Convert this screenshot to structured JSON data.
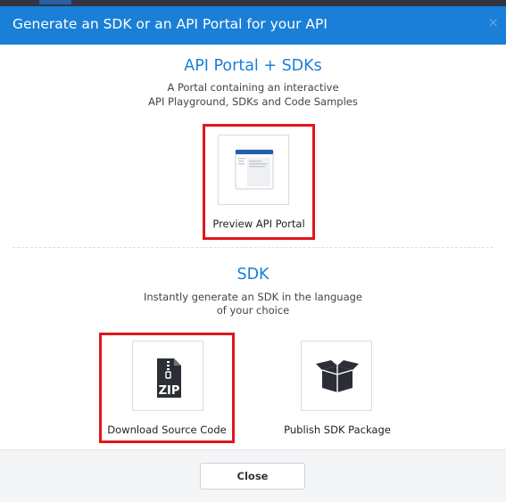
{
  "dialog": {
    "title": "Generate an SDK or an API Portal for your API",
    "close_glyph": "×"
  },
  "portal_section": {
    "title": "API Portal + SDKs",
    "description_line1": "A Portal containing an interactive",
    "description_line2": "API Playground, SDKs and Code Samples",
    "card_label": "Preview API Portal",
    "icon": "portal-preview-icon"
  },
  "sdk_section": {
    "title": "SDK",
    "description_line1": "Instantly generate an SDK in the language",
    "description_line2": "of your choice",
    "cards": [
      {
        "label": "Download Source Code",
        "icon": "zip-file-icon",
        "icon_text": "ZIP",
        "highlighted": true
      },
      {
        "label": "Publish SDK Package",
        "icon": "package-box-icon",
        "highlighted": false
      }
    ]
  },
  "footer": {
    "close_label": "Close"
  },
  "colors": {
    "header_bg": "#1a7fd6",
    "accent": "#1a7fd6",
    "highlight": "#e0161b",
    "footer_bg": "#f4f5f6"
  }
}
